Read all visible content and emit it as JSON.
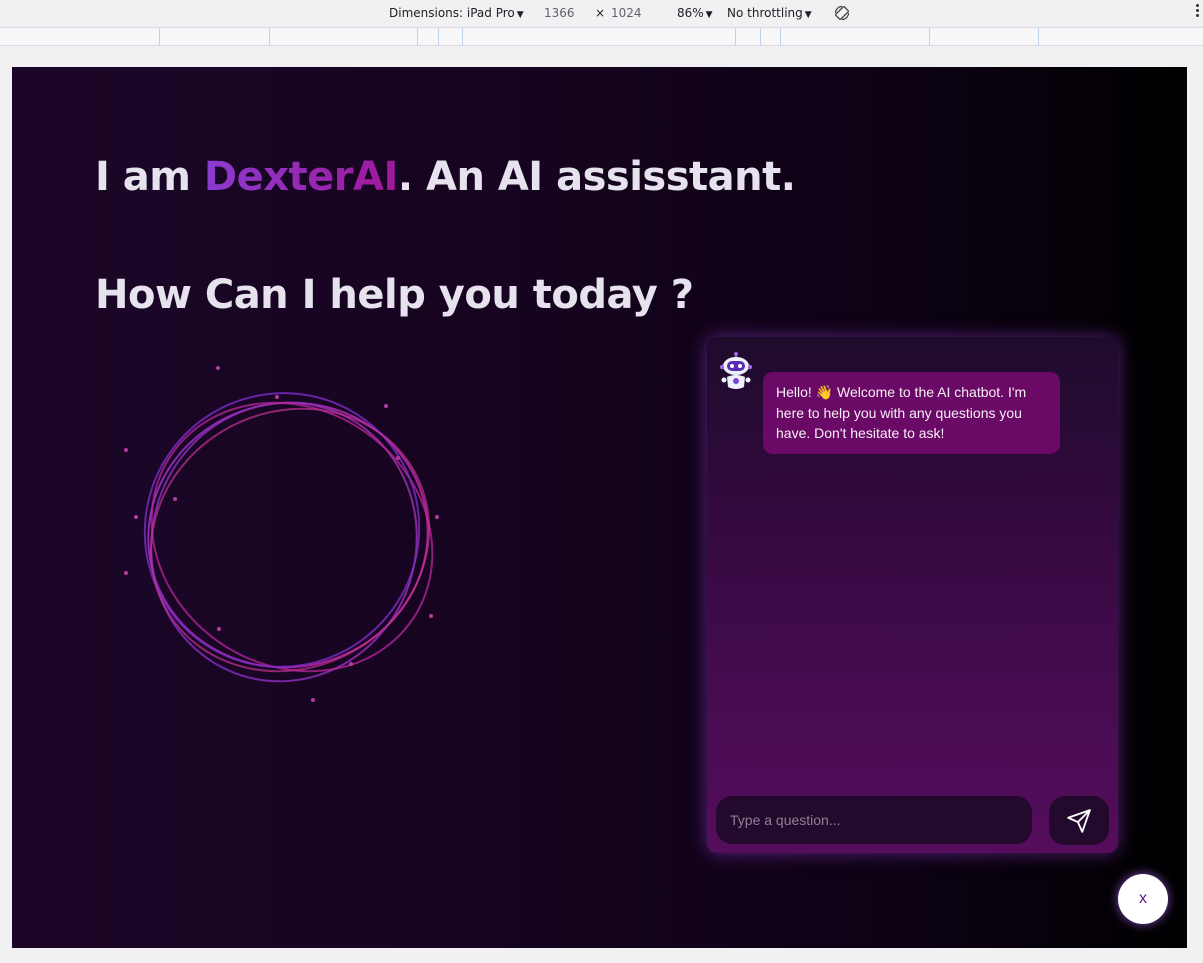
{
  "devtools": {
    "dimensions_label": "Dimensions: iPad Pro",
    "width": "1366",
    "times": "×",
    "height": "1024",
    "zoom": "86%",
    "throttling": "No throttling"
  },
  "hero": {
    "line1_prefix": "I am ",
    "brand": "DexterAI",
    "line1_suffix": ". An AI assisstant.",
    "line2": "How Can I help you today ?"
  },
  "chat": {
    "welcome_message": "Hello! 👋 Welcome to the AI chatbot. I'm here to help you with any questions you have. Don't hesitate to ask!",
    "input_placeholder": "Type a question...",
    "send_icon": "paper-plane-icon",
    "bot_icon": "robot-icon"
  },
  "toggle": {
    "close_label": "x"
  },
  "colors": {
    "brand_gradient_start": "#8b3bd0",
    "brand_gradient_end": "#a0189a",
    "panel_bottom": "#550d5c",
    "bubble": "#6b0a66"
  }
}
